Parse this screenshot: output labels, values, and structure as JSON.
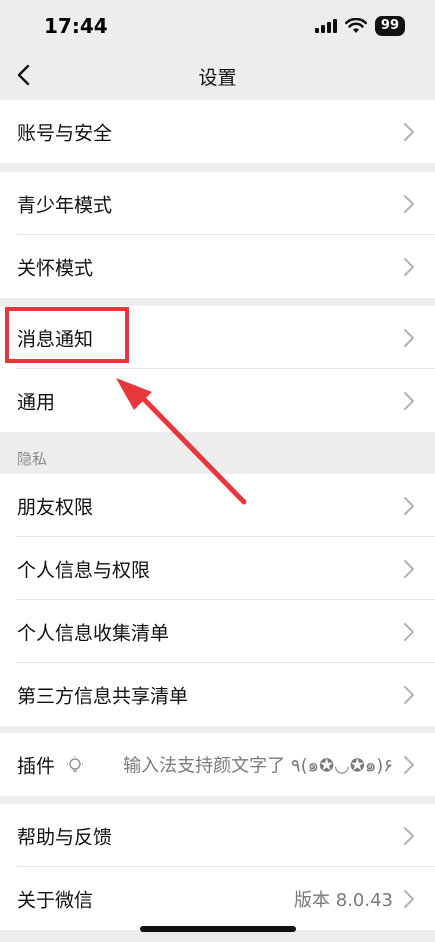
{
  "status_bar": {
    "time": "17:44",
    "battery": "99",
    "icons": [
      "signal-icon",
      "wifi-icon",
      "battery-icon"
    ]
  },
  "nav": {
    "title": "设置",
    "back_icon": "chevron-left-icon"
  },
  "groups": {
    "account": {
      "label": "账号与安全"
    },
    "youth": {
      "label": "青少年模式"
    },
    "care": {
      "label": "关怀模式"
    },
    "notifications": {
      "label": "消息通知"
    },
    "general": {
      "label": "通用"
    },
    "privacy_header": "隐私",
    "friend_permissions": {
      "label": "朋友权限"
    },
    "personal_info_permissions": {
      "label": "个人信息与权限"
    },
    "personal_info_collection": {
      "label": "个人信息收集清单"
    },
    "third_party_sharing": {
      "label": "第三方信息共享清单"
    },
    "plugins": {
      "label": "插件",
      "value": "输入法支持颜文字了 ٩(๑✪◡✪๑)۶"
    },
    "help": {
      "label": "帮助与反馈"
    },
    "about": {
      "label": "关于微信",
      "value": "版本 8.0.43"
    }
  },
  "annotation": {
    "highlight_color": "#e8373b",
    "target": "消息通知"
  },
  "colors": {
    "background": "#ededed",
    "row_background": "#ffffff",
    "secondary_text": "#7a7a7a",
    "accent_red": "#e8373b"
  }
}
